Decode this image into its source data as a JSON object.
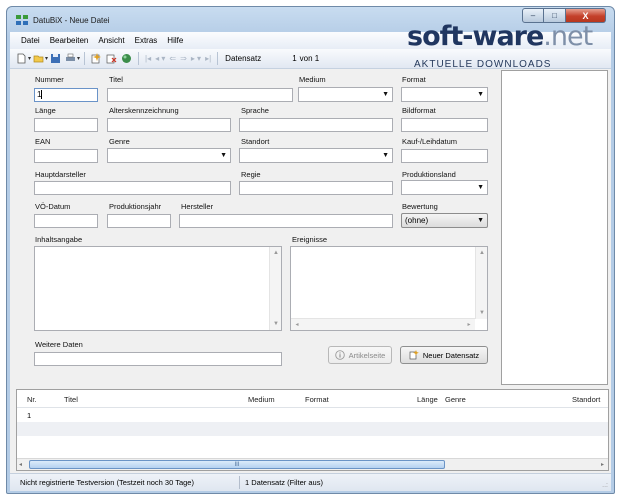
{
  "window": {
    "title": "DatuBiX - Neue Datei",
    "minimize": "–",
    "maximize": "□",
    "close": "X"
  },
  "watermark": {
    "brand_soft": "soft",
    "brand_dash": "-",
    "brand_ware": "ware",
    "brand_net": ".net",
    "tagline": "AKTUELLE DOWNLOADS"
  },
  "menu": [
    "Datei",
    "Bearbeiten",
    "Ansicht",
    "Extras",
    "Hilfe"
  ],
  "toolbar": {
    "label": "Datensatz",
    "position": "1",
    "of_total": "von 1"
  },
  "fields": {
    "nummer": {
      "label": "Nummer",
      "value": "1"
    },
    "titel": {
      "label": "Titel",
      "value": ""
    },
    "medium": {
      "label": "Medium",
      "value": ""
    },
    "format": {
      "label": "Format",
      "value": ""
    },
    "laenge": {
      "label": "Länge",
      "value": ""
    },
    "alterskennzeichnung": {
      "label": "Alterskennzeichnung",
      "value": ""
    },
    "sprache": {
      "label": "Sprache",
      "value": ""
    },
    "bildformat": {
      "label": "Bildformat",
      "value": ""
    },
    "ean": {
      "label": "EAN",
      "value": ""
    },
    "genre": {
      "label": "Genre",
      "value": ""
    },
    "standort": {
      "label": "Standort",
      "value": ""
    },
    "kauf_leihdatum": {
      "label": "Kauf-/Leihdatum",
      "value": ""
    },
    "hauptdarsteller": {
      "label": "Hauptdarsteller",
      "value": ""
    },
    "regie": {
      "label": "Regie",
      "value": ""
    },
    "produktionsland": {
      "label": "Produktionsland",
      "value": ""
    },
    "vo_datum": {
      "label": "VÖ-Datum",
      "value": ""
    },
    "produktionsjahr": {
      "label": "Produktionsjahr",
      "value": ""
    },
    "hersteller": {
      "label": "Hersteller",
      "value": ""
    },
    "bewertung": {
      "label": "Bewertung",
      "value": "(ohne)"
    },
    "inhaltsangabe": {
      "label": "Inhaltsangabe",
      "value": ""
    },
    "ereignisse": {
      "label": "Ereignisse",
      "value": ""
    },
    "weitere_daten": {
      "label": "Weitere Daten",
      "value": ""
    }
  },
  "buttons": {
    "artikelseite": "Artikelseite",
    "neuer_datensatz": "Neuer Datensatz"
  },
  "grid": {
    "columns": [
      "Nr.",
      "Titel",
      "Medium",
      "Format",
      "Länge",
      "Genre",
      "Standort"
    ],
    "rows": [
      {
        "nr": "1"
      }
    ],
    "scroll_grip": "III"
  },
  "status": {
    "left": "Nicht registrierte Testversion (Testzeit noch 30 Tage)",
    "right": "1 Datensatz (Filter aus)",
    "grip": "..:"
  },
  "colors": {
    "accent": "#203660",
    "titlebar": "#c8dcf0",
    "close": "#c4402a"
  },
  "icons": [
    "app-icon",
    "new-doc-icon",
    "open-folder-icon",
    "save-icon",
    "print-icon",
    "copy-record-icon",
    "delete-record-icon",
    "globe-icon",
    "first-record-icon",
    "prev-record-icon",
    "next-record-icon",
    "last-record-icon",
    "info-icon",
    "new-record-icon"
  ]
}
